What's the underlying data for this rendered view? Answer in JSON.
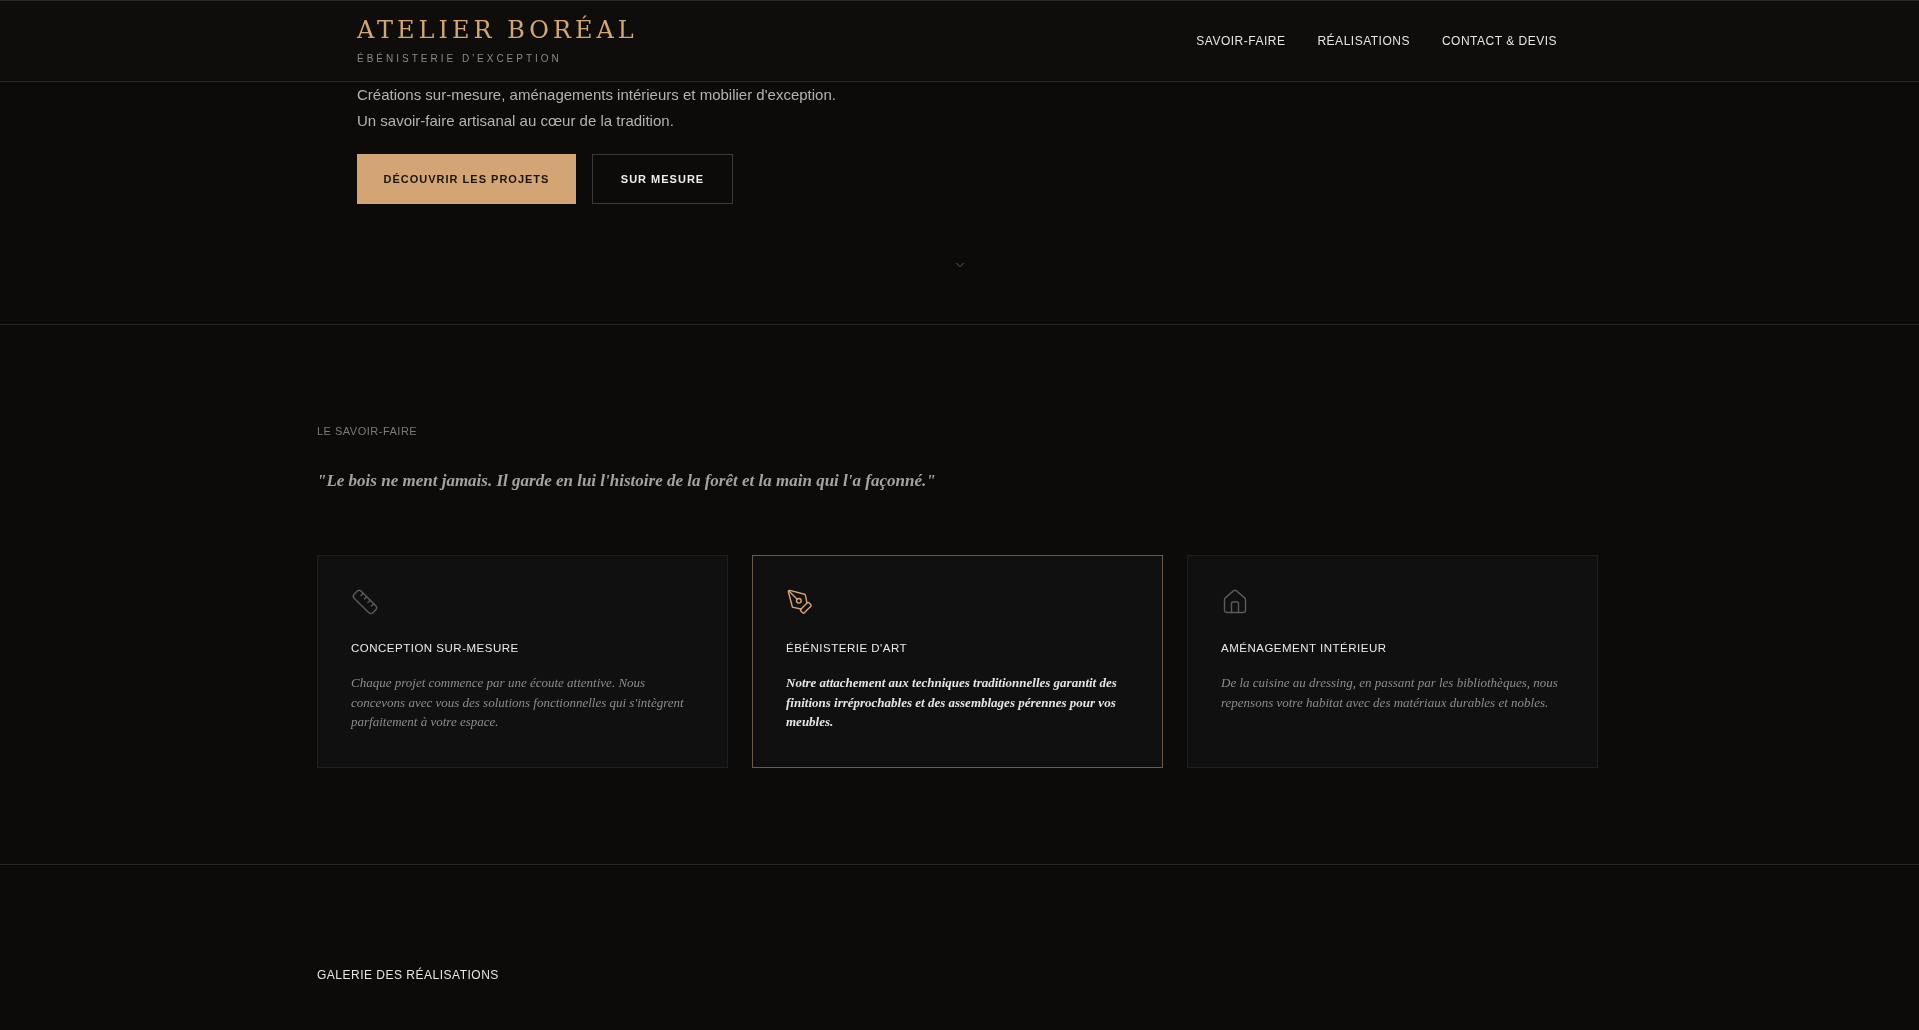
{
  "header": {
    "logo": "ATELIER BORÉAL",
    "tagline": "ÉBÉNISTERIE D'EXCEPTION",
    "nav": [
      "SAVOIR-FAIRE",
      "RÉALISATIONS",
      "CONTACT & DEVIS"
    ]
  },
  "hero": {
    "lines": [
      "Créations sur-mesure, aménagements intérieurs et mobilier d'exception.",
      "Un savoir-faire artisanal au cœur de la tradition."
    ],
    "buttons": [
      {
        "label": "DÉCOUVRIR LES PROJETS",
        "kind": "primary"
      },
      {
        "label": "SUR MESURE",
        "kind": "outline"
      }
    ]
  },
  "savoir_faire": {
    "label": "LE SAVOIR-FAIRE",
    "quote": "\"Le bois ne ment jamais. Il garde en lui l'histoire de la forêt et la main qui l'a façonné.\"",
    "cards": [
      {
        "kind": "ruler",
        "title": "CONCEPTION SUR-MESURE",
        "text": "Chaque projet commence par une écoute attentive. Nous concevons avec vous des solutions fonctionnelles qui s'intègrent parfaitement à votre espace.",
        "selected": false
      },
      {
        "kind": "pen",
        "title": "ÉBÉNISTERIE D'ART",
        "text": "Notre attachement aux techniques traditionnelles garantit des finitions irréprochables et des assemblages pérennes pour vos meubles.",
        "selected": true
      },
      {
        "kind": "house",
        "title": "AMÉNAGEMENT INTÉRIEUR",
        "text": "De la cuisine au dressing, en passant par les bibliothèques, nous repensons votre habitat avec des matériaux durables et nobles.",
        "selected": false
      }
    ]
  },
  "gallery": {
    "label": "GALERIE DES RÉALISATIONS"
  }
}
